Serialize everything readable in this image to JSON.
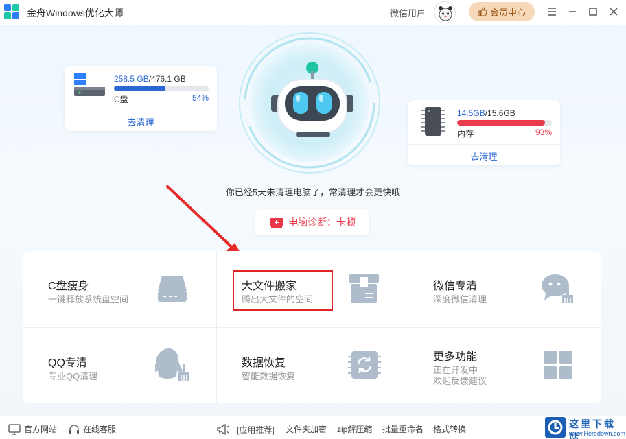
{
  "app": {
    "title": "金舟Windows优化大师"
  },
  "header": {
    "user_name": "微信用户",
    "vip_label": "会员中心"
  },
  "disk_c": {
    "used": "258.5 GB",
    "separator": "/",
    "total": "476.1 GB",
    "label": "C盘",
    "percent_text": "54%",
    "percent": 54,
    "clean_label": "去清理",
    "bar_color": "#2a67d4"
  },
  "memory": {
    "used": "14.5GB",
    "separator": "/",
    "total": "15.6GB",
    "label": "内存",
    "percent_text": "93%",
    "percent": 93,
    "clean_label": "去清理",
    "bar_color": "#ea3a4e"
  },
  "message": "你已经5天未清理电脑了，常清理才会更快哦",
  "diagnosis": {
    "label": "电脑诊断：卡顿"
  },
  "features": [
    {
      "title": "C盘瘦身",
      "subtitle": "一键释放系统盘空间",
      "icon": "drive-icon"
    },
    {
      "title": "大文件搬家",
      "subtitle": "腾出大文件的空间",
      "icon": "box-icon"
    },
    {
      "title": "微信专清",
      "subtitle": "深度微信清理",
      "icon": "chat-broom-icon"
    },
    {
      "title": "QQ专清",
      "subtitle": "专业QQ清理",
      "icon": "penguin-broom-icon"
    },
    {
      "title": "数据恢复",
      "subtitle": "智能数据恢复",
      "icon": "chip-refresh-icon"
    },
    {
      "title": "更多功能",
      "subtitle": "正在开发中",
      "subtitle2": "欢迎反馈建议",
      "icon": "grid-icon"
    }
  ],
  "footer": {
    "website": "官方网站",
    "support": "在线客服",
    "recommend": "[应用推荐]",
    "links": [
      "文件夹加密",
      "zip解压缩",
      "批量重命名",
      "格式转换"
    ]
  },
  "watermark": {
    "title": "这里下载站",
    "url": "www.Heredown.com"
  },
  "colors": {
    "accent": "#2a67d4",
    "danger": "#ea3a4e",
    "vip_bg": "#f5d9b9",
    "highlight": "#e02424"
  }
}
